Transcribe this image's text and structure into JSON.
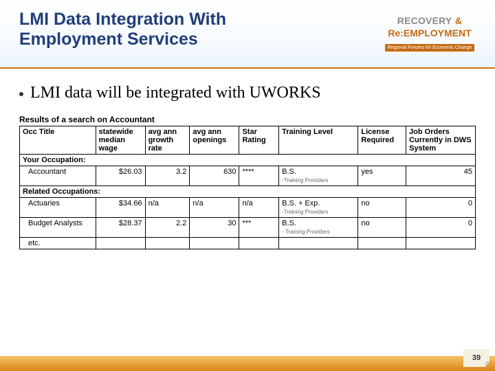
{
  "header": {
    "title": "LMI Data Integration With Employment Services",
    "logo": {
      "t1": "RECOVERY",
      "amp": "&",
      "t2": "Re:EMPLOYMENT",
      "sub": "Regional Forums for Economic Change"
    }
  },
  "bullet": "LMI data will be integrated with UWORKS",
  "search_caption": "Results of a search on Accountant",
  "columns": {
    "occ": "Occ Title",
    "wage": "statewide median wage",
    "growth": "avg ann growth rate",
    "open": "avg ann openings",
    "star": "Star Rating",
    "train": "Training Level",
    "lic": "License Required",
    "job": "Job Orders Currently in DWS System"
  },
  "sections": {
    "your_occ": "Your Occupation:",
    "related": "Related Occupations:"
  },
  "rows": [
    {
      "occ": "Accountant",
      "wage": "$26.03",
      "growth": "3.2",
      "open": "630",
      "star": "****",
      "train": "B.S.",
      "tp": "-Training Providers",
      "lic": "yes",
      "job": "45"
    },
    {
      "occ": "Actuaries",
      "wage": "$34.66",
      "growth": "n/a",
      "open": "n/a",
      "star": "n/a",
      "train": "B.S. + Exp.",
      "tp": "-Training Providers",
      "lic": "no",
      "job": "0"
    },
    {
      "occ": "Budget Analysts",
      "wage": "$28.37",
      "growth": "2.2",
      "open": "30",
      "star": "***",
      "train": "B.S.",
      "tp": "- Training Providers",
      "lic": "no",
      "job": "0"
    }
  ],
  "etc": "etc.",
  "page_no": "39"
}
